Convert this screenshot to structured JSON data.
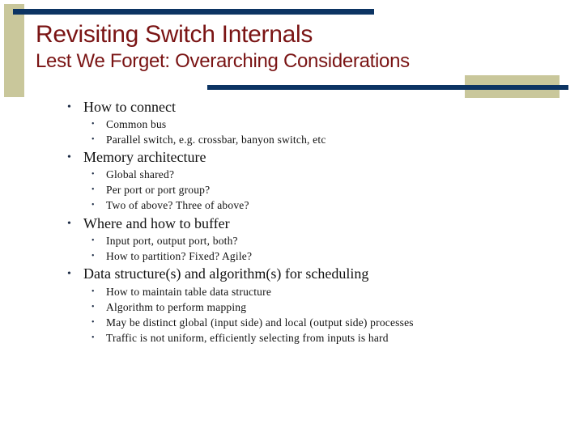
{
  "slide": {
    "title": "Revisiting Switch Internals",
    "subtitle": "Lest We Forget: Overarching Considerations",
    "colors": {
      "title": "#7a1414",
      "accent_navy": "#0c3463",
      "accent_tan": "#c9c79b",
      "body_text": "#111111"
    },
    "bullet_glyph": "•",
    "sections": [
      {
        "heading": "How to connect",
        "items": [
          "Common bus",
          "Parallel switch, e.g. crossbar, banyon switch, etc"
        ]
      },
      {
        "heading": "Memory architecture",
        "items": [
          "Global shared?",
          "Per port or port group?",
          "Two of above? Three of above?"
        ]
      },
      {
        "heading": "Where and how to buffer",
        "items": [
          "Input port, output port, both?",
          "How to partition? Fixed? Agile?"
        ]
      },
      {
        "heading": "Data structure(s) and algorithm(s) for scheduling",
        "items": [
          "How to maintain table data structure",
          "Algorithm to perform mapping",
          "May be distinct global (input side) and local (output side) processes",
          "Traffic is not uniform, efficiently selecting from inputs is hard"
        ]
      }
    ]
  }
}
